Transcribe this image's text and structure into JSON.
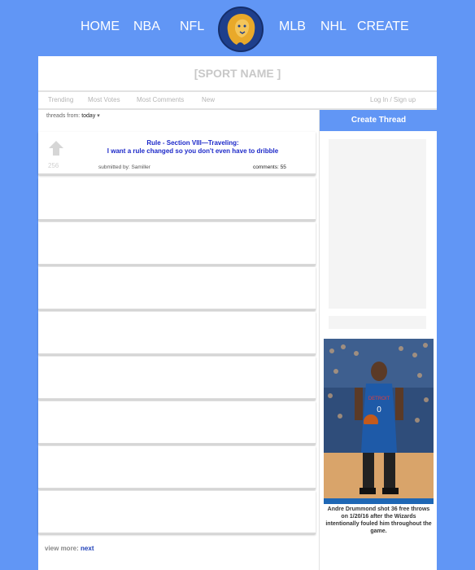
{
  "nav": {
    "items": [
      "HOME",
      "NBA",
      "NFL",
      "MLB",
      "NHL",
      "CREATE"
    ]
  },
  "header": {
    "sport_name": "[SPORT NAME ]"
  },
  "tabs": {
    "items": [
      "Trending",
      "Most Votes",
      "Most Comments",
      "New"
    ],
    "login": "Log In / Sign up"
  },
  "filter": {
    "label": "threads from:",
    "value": "today"
  },
  "threads": [
    {
      "title_line1": "Rule - Section VIII—Traveling:",
      "title_line2": "I want a rule changed so you don't even have to dribble",
      "votes": "256",
      "submitted_by": "submitted by: Samiller",
      "comments": "comments: 55"
    }
  ],
  "sidebar": {
    "create_label": "Create Thread",
    "caption": "Andre Drummond shot 36 free throws on 1/20/16 after the Wizards intentionally fouled him throughout the game."
  },
  "pager": {
    "label": "view more:",
    "next": "next"
  },
  "colors": {
    "page_bg": "#6196f5",
    "link": "#1d29c9",
    "logo_gold": "#e9a92a",
    "logo_navy": "#1e3f8c"
  }
}
